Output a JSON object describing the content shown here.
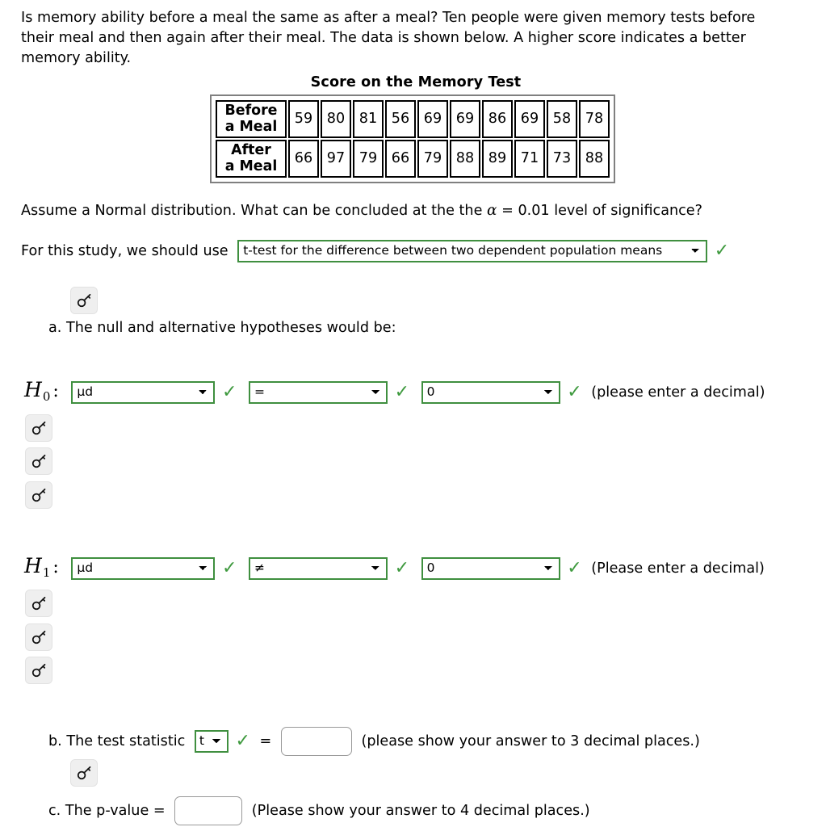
{
  "intro": {
    "paragraph": "Is memory ability before a meal the same as after a meal?  Ten people were given memory tests before their meal and then again after their meal. The data is shown below. A higher score indicates a better memory ability."
  },
  "table": {
    "title": "Score on the Memory Test",
    "rows": [
      {
        "label_line1": "Before",
        "label_line2": "a Meal",
        "values": [
          "59",
          "80",
          "81",
          "56",
          "69",
          "69",
          "86",
          "69",
          "58",
          "78"
        ]
      },
      {
        "label_line1": "After",
        "label_line2": "a Meal",
        "values": [
          "66",
          "97",
          "79",
          "66",
          "79",
          "88",
          "89",
          "71",
          "73",
          "88"
        ]
      }
    ]
  },
  "assume": {
    "text_before_alpha": "Assume a Normal distribution.  What can be concluded at the the ",
    "alpha_symbol": "α",
    "alpha_rest": " = 0.01 level of significance?"
  },
  "study": {
    "prompt": "For this study, we should use",
    "test_select_value": "t-test for the difference between two dependent population means",
    "check": "✓"
  },
  "part_a": {
    "label": "a. The null and alternative hypotheses would be:"
  },
  "h0": {
    "symbol": "H",
    "subscript": "0",
    "colon": ":",
    "param_value": "μd",
    "operator_value": "=",
    "number_value": "0",
    "note": "(please enter a decimal)",
    "check": "✓"
  },
  "h1": {
    "symbol": "H",
    "subscript": "1",
    "colon": ":",
    "param_value": "μd",
    "operator_value": "≠",
    "number_value": "0",
    "note": "(Please enter a decimal)",
    "check": "✓"
  },
  "part_b": {
    "label": "b. The test statistic",
    "stat_select_value": "t",
    "check": "✓",
    "equals": "=",
    "input_value": "",
    "input_placeholder": "",
    "note": "(please show your answer to 3 decimal places.)"
  },
  "part_c": {
    "label": "c. The p-value =",
    "input_value": "",
    "input_placeholder": "",
    "note": "(Please show your answer to 4 decimal places.)"
  },
  "icons": {
    "key": "key-icon"
  },
  "colors": {
    "valid_green": "#3f8f3f",
    "check_green": "#3f9a3f",
    "input_border": "#999999",
    "button_bg": "#efefef"
  }
}
